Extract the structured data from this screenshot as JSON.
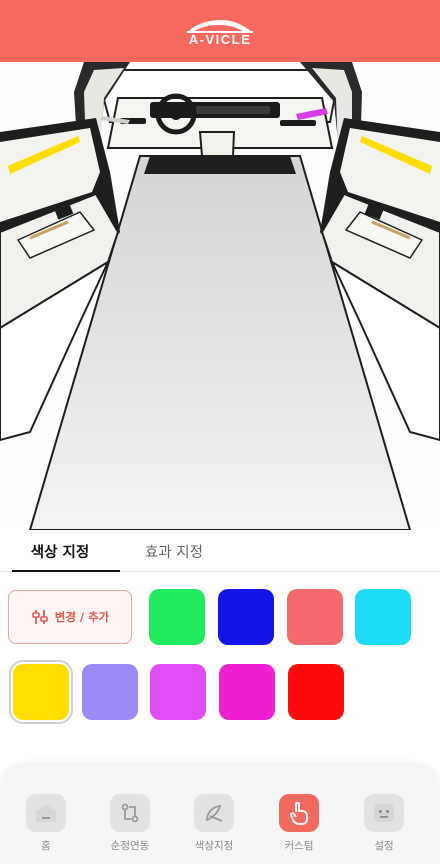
{
  "header": {
    "logo_text": "A-VICLE"
  },
  "tabs": [
    {
      "label": "색상 지정",
      "active": true
    },
    {
      "label": "효과 지정",
      "active": false
    }
  ],
  "color_panel": {
    "edit_label": "변경 / 추가",
    "swatches": [
      {
        "color": "#22ea5e",
        "selected": false
      },
      {
        "color": "#1414e6",
        "selected": false
      },
      {
        "color": "#f56b6b",
        "selected": false
      },
      {
        "color": "#1edcf7",
        "selected": false
      },
      {
        "color": "#ffde00",
        "selected": true
      },
      {
        "color": "#9b8af8",
        "selected": false
      },
      {
        "color": "#df4ef2",
        "selected": false
      },
      {
        "color": "#ef1fd2",
        "selected": false
      },
      {
        "color": "#ff0a0a",
        "selected": false
      }
    ]
  },
  "ambient_lights": {
    "left": "#ffde00",
    "right": "#ffde00",
    "dashboard": "#d63ce8"
  },
  "nav": {
    "items": [
      {
        "label": "홈",
        "icon": "home-icon",
        "active": false
      },
      {
        "label": "순정연동",
        "icon": "sync-icon",
        "active": false
      },
      {
        "label": "색상지정",
        "icon": "paint-icon",
        "active": false
      },
      {
        "label": "커스텀",
        "icon": "touch-icon",
        "active": true
      },
      {
        "label": "설정",
        "icon": "settings-face-icon",
        "active": false
      }
    ]
  }
}
